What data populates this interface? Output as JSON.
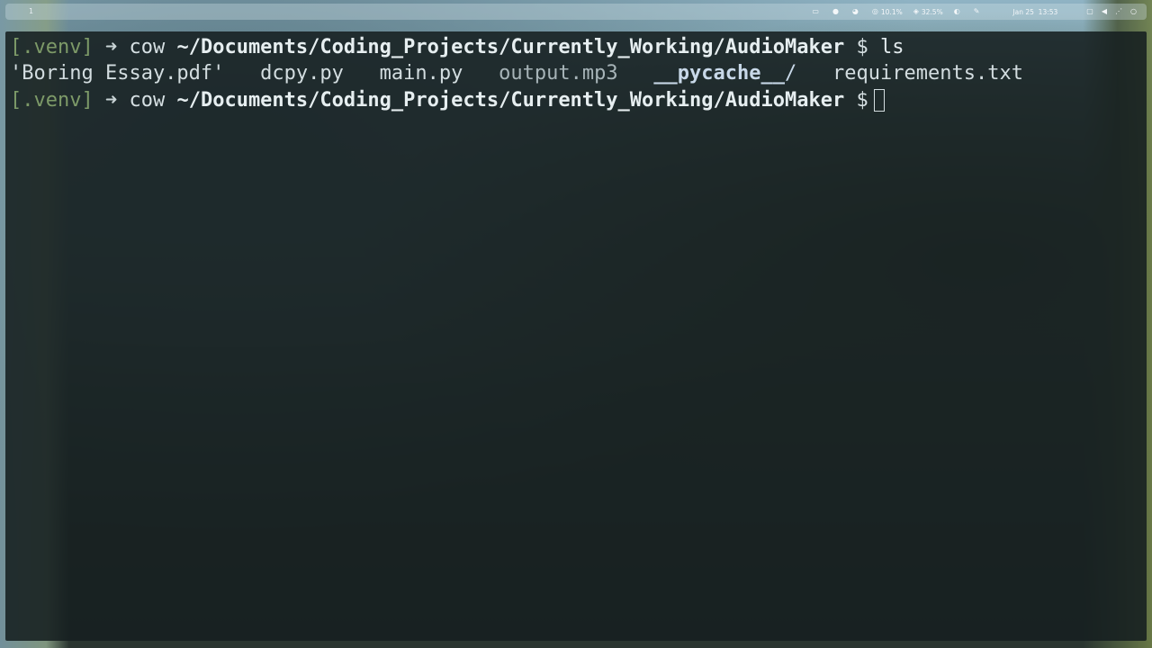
{
  "topbar": {
    "workspace": "1",
    "cpu": "10.1%",
    "memory": "32.5%",
    "date": "Jan 25",
    "time": "13:53",
    "icons": [
      "window-icon",
      "github-icon",
      "discord-icon",
      "cpu-icon",
      "memory-icon",
      "theme-icon",
      "pen-icon",
      "display-icon",
      "volume-icon",
      "power-icon"
    ]
  },
  "terminal": {
    "venv": "[.venv]",
    "arrow": "➜",
    "user": "cow",
    "path": "~/Documents/Coding_Projects/Currently_Working/AudioMaker",
    "dollar": "$",
    "command": "ls",
    "files": {
      "pdf": "'Boring Essay.pdf'",
      "py1": "dcpy.py",
      "py2": "main.py",
      "mp3": "output.mp3",
      "dir_name": "__pycache__",
      "dir_slash": "/",
      "txt": "requirements.txt"
    }
  },
  "colors": {
    "terminal_bg": "#161f20",
    "venv": "#7d9a68",
    "text": "#d3dde0"
  }
}
